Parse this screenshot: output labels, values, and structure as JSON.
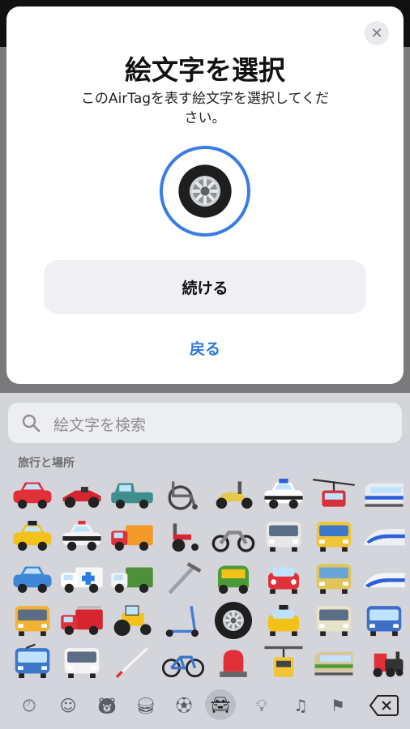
{
  "sheet": {
    "title": "絵文字を選択",
    "subtitle": "このAirTagを表す絵文字を選択してください。",
    "selected_emoji": "tire",
    "continue_label": "続ける",
    "back_label": "戻る",
    "close_icon": "close-icon"
  },
  "keyboard": {
    "search_placeholder": "絵文字を検索",
    "category_label": "旅行と場所",
    "emojis": [
      [
        "red-car",
        "race-car",
        "pickup-truck",
        "manual-wheelchair",
        "motor-scooter",
        "police-car-light-bar",
        "aerial-tramway",
        "monorail"
      ],
      [
        "taxi",
        "police-car",
        "delivery-truck",
        "motorized-wheelchair",
        "motorcycle",
        "oncoming-bus",
        "light-rail",
        "bullet-train"
      ],
      [
        "blue-suv",
        "ambulance",
        "articulated-lorry",
        "crutch",
        "auto-rickshaw",
        "oncoming-automobile",
        "tram-car",
        "high-speed-train"
      ],
      [
        "bus",
        "fire-engine",
        "tractor",
        "kick-scooter",
        "wheel",
        "oncoming-taxi",
        "tram",
        "train"
      ],
      [
        "trolleybus",
        "minibus",
        "white-cane",
        "bicycle",
        "police-light",
        "suspension-railway",
        "mountain-railway",
        "steam-locomotive"
      ]
    ],
    "categories": [
      "recent",
      "smileys",
      "animals",
      "food",
      "sports",
      "travel",
      "objects",
      "symbols",
      "flags"
    ],
    "active_category": "travel",
    "accent_color": "#3a7ce6"
  }
}
